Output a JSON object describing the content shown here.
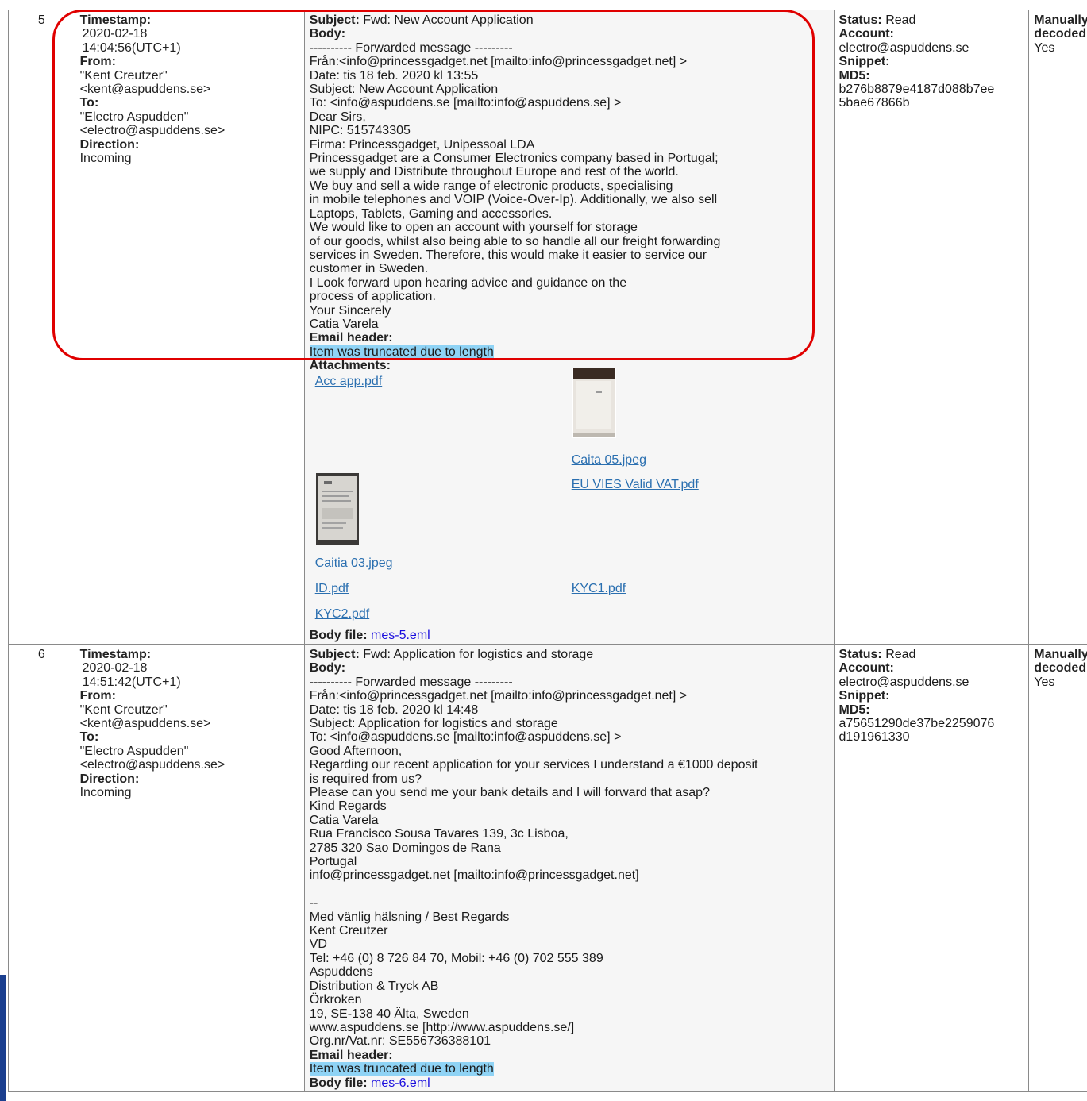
{
  "rows": [
    {
      "num": "5",
      "timestamp_label": "Timestamp:",
      "timestamp_date": "2020-02-18",
      "timestamp_time": "14:04:56(UTC+1)",
      "from_label": "From:",
      "from_name": "\"Kent Creutzer\"",
      "from_email": "<kent@aspuddens.se>",
      "to_label": "To:",
      "to_name": "\"Electro Aspudden\"",
      "to_email": "<electro@aspuddens.se>",
      "direction_label": "Direction:",
      "direction_value": "Incoming",
      "subject_label": "Subject:",
      "subject_value": "Fwd: New Account Application",
      "body_label": "Body:",
      "body_lines": [
        "---------- Forwarded message ---------",
        "Från:<info@princessgadget.net [mailto:info@princessgadget.net] >",
        "Date: tis 18 feb. 2020 kl 13:55",
        "Subject: New Account Application",
        "To:  <info@aspuddens.se [mailto:info@aspuddens.se] >",
        "Dear Sirs,",
        "NIPC: 515743305",
        "Firma: Princessgadget, Unipessoal LDA",
        "Princessgadget are a Consumer Electronics company based in Portugal;",
        "we supply and Distribute throughout Europe and rest of the world.",
        "We buy and sell a wide range of electronic products, specialising",
        "in mobile telephones and VOIP (Voice-Over-Ip). Additionally, we also sell",
        "Laptops, Tablets, Gaming and accessories.",
        "We would like to open an account with yourself for storage",
        "of our goods, whilst also being able to so handle all our freight forwarding",
        "services in Sweden. Therefore, this would make it easier to service our",
        "customer in Sweden.",
        "I Look forward upon hearing advice and guidance on the",
        "process of application.",
        "Your Sincerely",
        "Catia Varela"
      ],
      "email_header_label": "Email header:",
      "email_header_value": "Item was truncated due to length",
      "attachments_label": "Attachments:",
      "attachments": {
        "acc_app": "Acc app.pdf",
        "caita05": "Caita 05.jpeg",
        "eu_vies": "EU VIES Valid VAT.pdf",
        "caitia03": "Caitia 03.jpeg",
        "id": "ID.pdf",
        "kyc1": "KYC1.pdf",
        "kyc2": "KYC2.pdf"
      },
      "body_file_label": "Body file:",
      "body_file_value": "mes-5.eml",
      "status_label": "Status:",
      "status_value": "Read",
      "account_label": "Account:",
      "account_value": "electro@aspuddens.se",
      "snippet_label": "Snippet:",
      "md5_label": "MD5:",
      "md5_line1": "b276b8879e4187d088b7ee",
      "md5_line2": "5bae67866b",
      "manual_label_1": "Manually",
      "manual_label_2": "decoded:",
      "manual_value": "Yes"
    },
    {
      "num": "6",
      "timestamp_label": "Timestamp:",
      "timestamp_date": "2020-02-18",
      "timestamp_time": "14:51:42(UTC+1)",
      "from_label": "From:",
      "from_name": "\"Kent Creutzer\"",
      "from_email": "<kent@aspuddens.se>",
      "to_label": "To:",
      "to_name": "\"Electro Aspudden\"",
      "to_email": "<electro@aspuddens.se>",
      "direction_label": "Direction:",
      "direction_value": "Incoming",
      "subject_label": "Subject:",
      "subject_value": "Fwd: Application for logistics and storage",
      "body_label": "Body:",
      "body_lines": [
        "---------- Forwarded message ---------",
        "Från:<info@princessgadget.net [mailto:info@princessgadget.net] >",
        "Date: tis 18 feb. 2020 kl 14:48",
        "Subject: Application for logistics and storage",
        "To:  <info@aspuddens.se [mailto:info@aspuddens.se] >",
        "Good Afternoon,",
        "Regarding our recent application for your services I understand a €1000 deposit",
        "is required from us?",
        "Please can you send me your bank details and I will forward that asap?",
        "Kind Regards",
        "Catia Varela",
        "Rua Francisco Sousa Tavares 139, 3c Lisboa,",
        "2785 320 Sao Domingos de Rana",
        "Portugal",
        "info@princessgadget.net [mailto:info@princessgadget.net]",
        "",
        "--",
        "Med vänlig hälsning / Best Regards",
        "Kent Creutzer",
        "VD",
        "Tel: +46 (0) 8 726 84 70, Mobil: +46 (0) 702 555 389",
        "Aspuddens",
        "Distribution & Tryck AB",
        "Örkroken",
        "19, SE-138 40 Älta, Sweden",
        "www.aspuddens.se [http://www.aspuddens.se/]",
        "Org.nr/Vat.nr: SE556736388101"
      ],
      "email_header_label": "Email header:",
      "email_header_value": "Item was truncated due to length",
      "body_file_label": "Body file:",
      "body_file_value": "mes-6.eml",
      "status_label": "Status:",
      "status_value": "Read",
      "account_label": "Account:",
      "account_value": "electro@aspuddens.se",
      "snippet_label": "Snippet:",
      "md5_label": "MD5:",
      "md5_line1": "a75651290de37be2259076",
      "md5_line2": "d191961330",
      "manual_label_1": "Manually",
      "manual_label_2": "decoded:",
      "manual_value": "Yes"
    }
  ],
  "colors": {
    "highlight": "#8fd3f5",
    "annotation_box": "#e00000",
    "link": "#2a6fb0",
    "body_file_link": "#1a0dde"
  }
}
